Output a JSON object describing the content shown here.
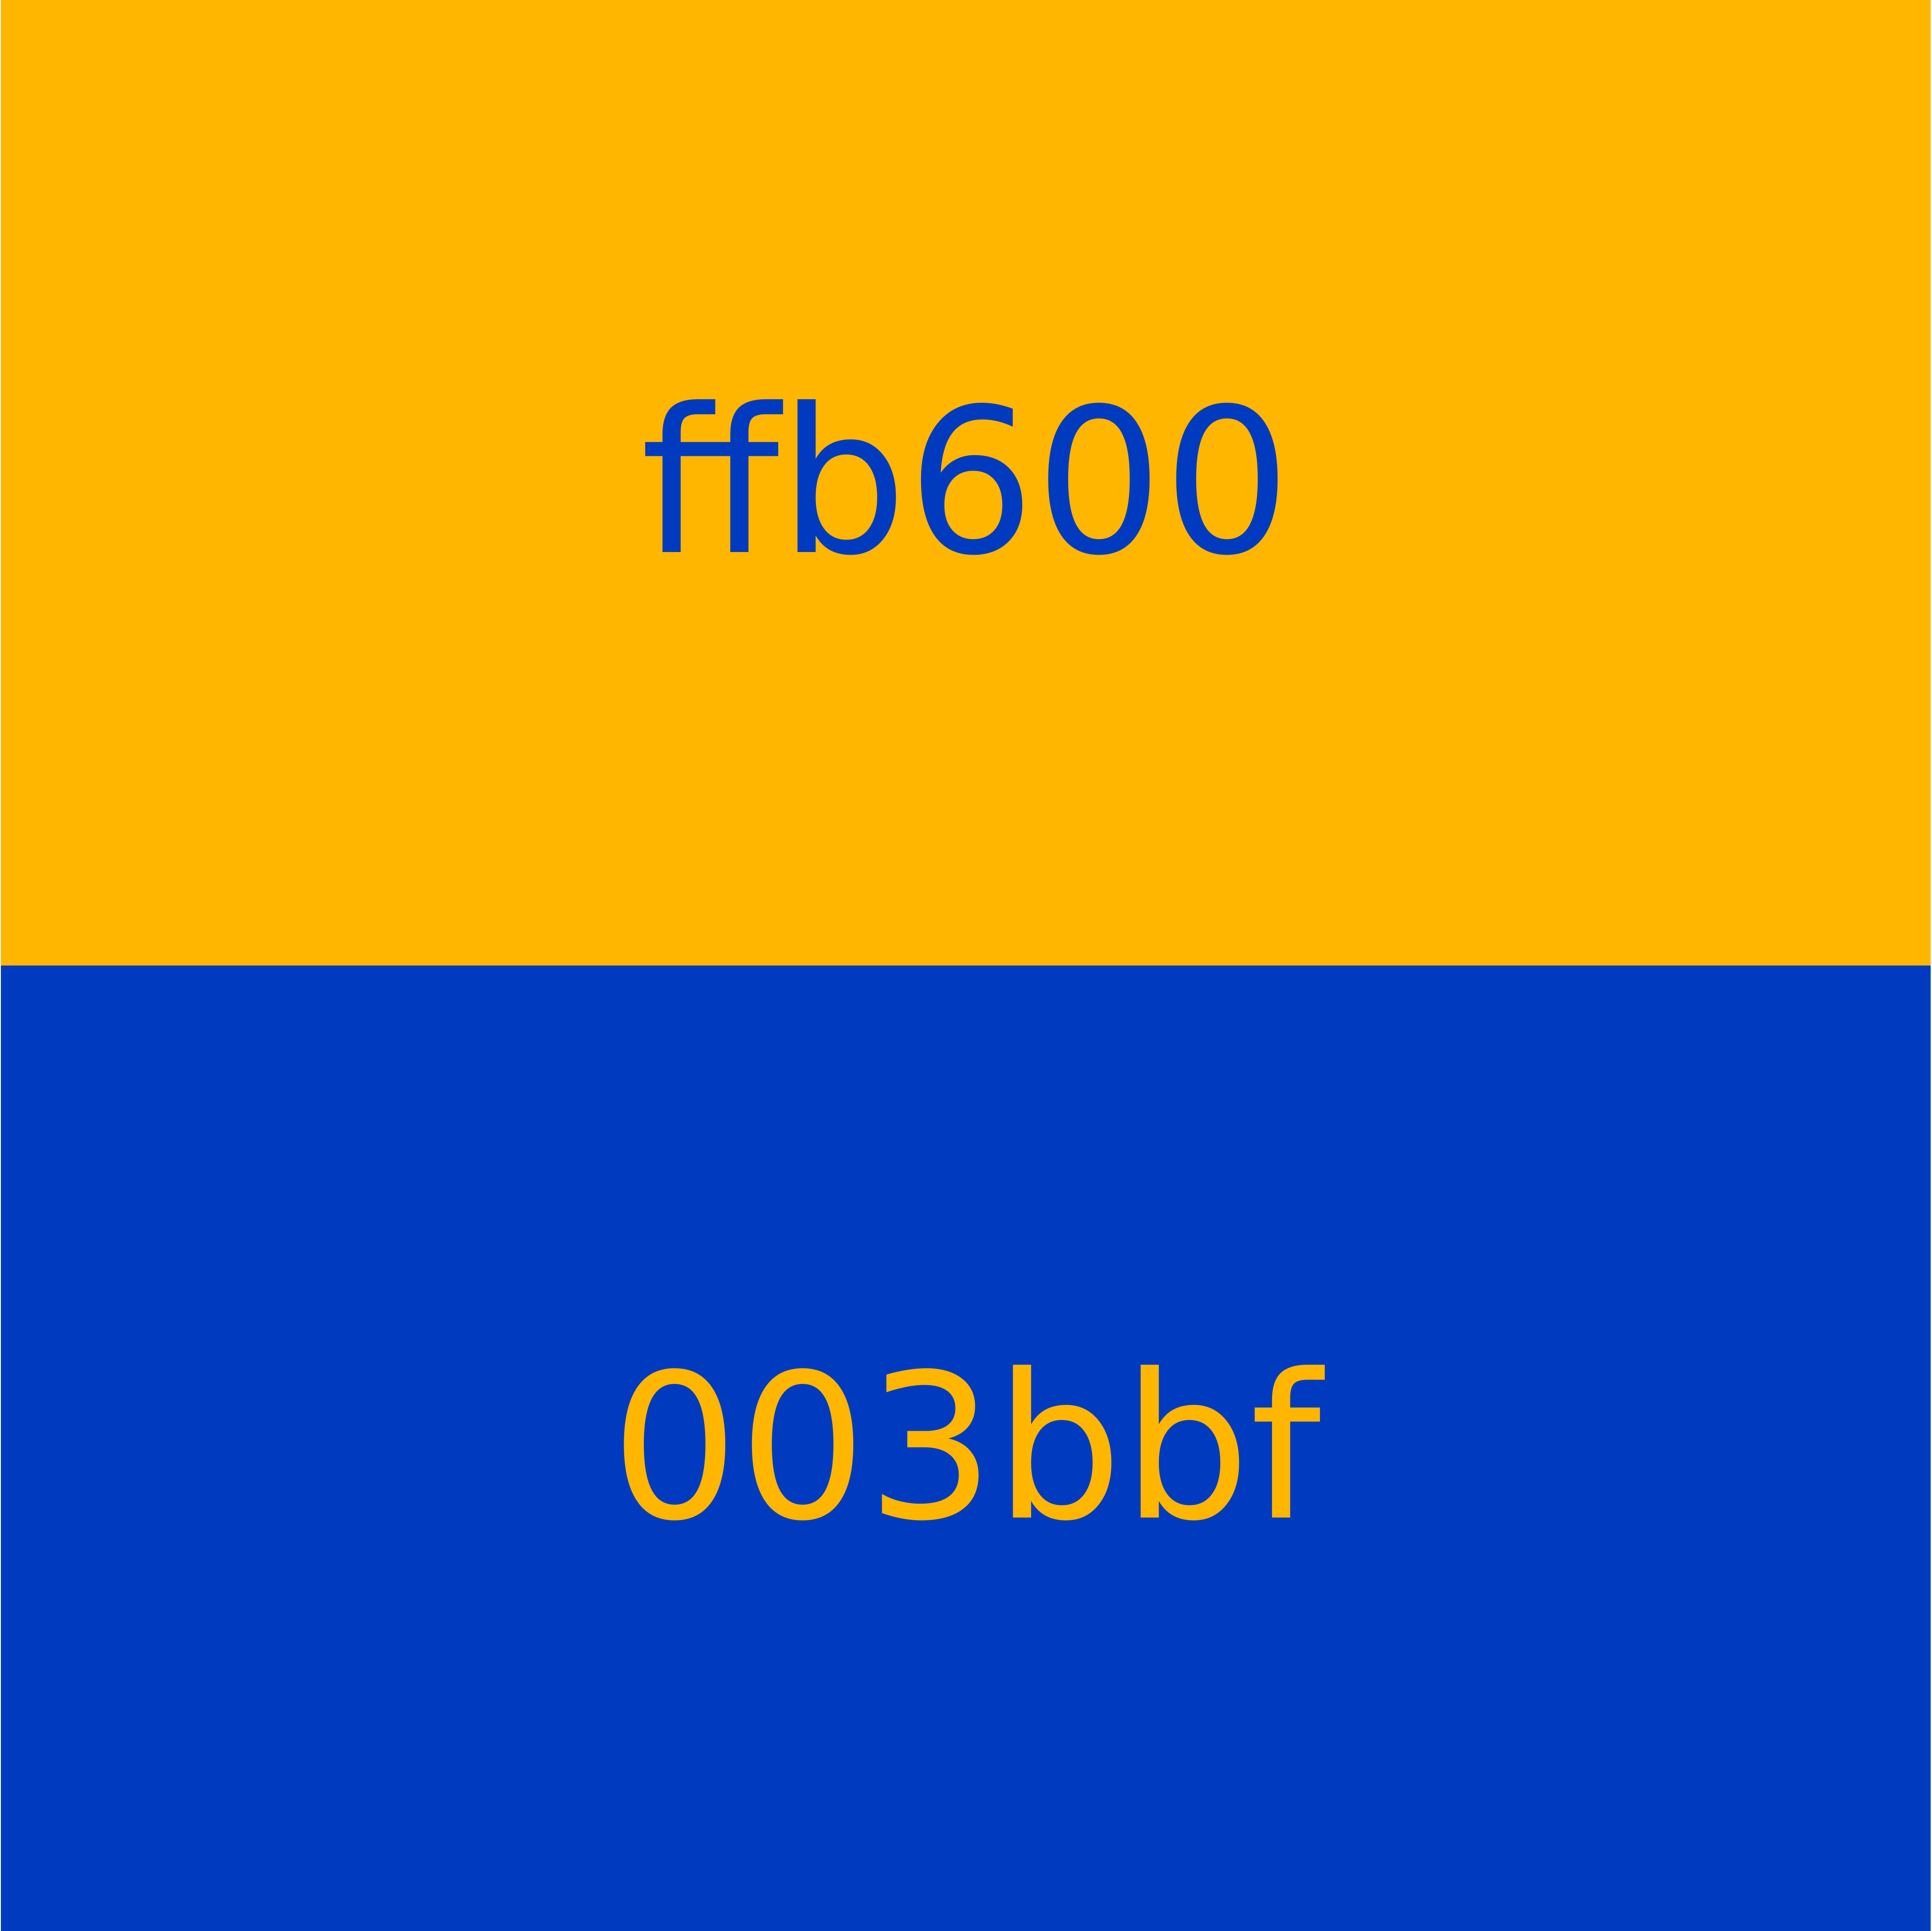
{
  "swatches": [
    {
      "label": "ffb600",
      "background": "#ffb600",
      "text_color": "#003bbf"
    },
    {
      "label": "003bbf",
      "background": "#003bbf",
      "text_color": "#ffb600"
    }
  ]
}
